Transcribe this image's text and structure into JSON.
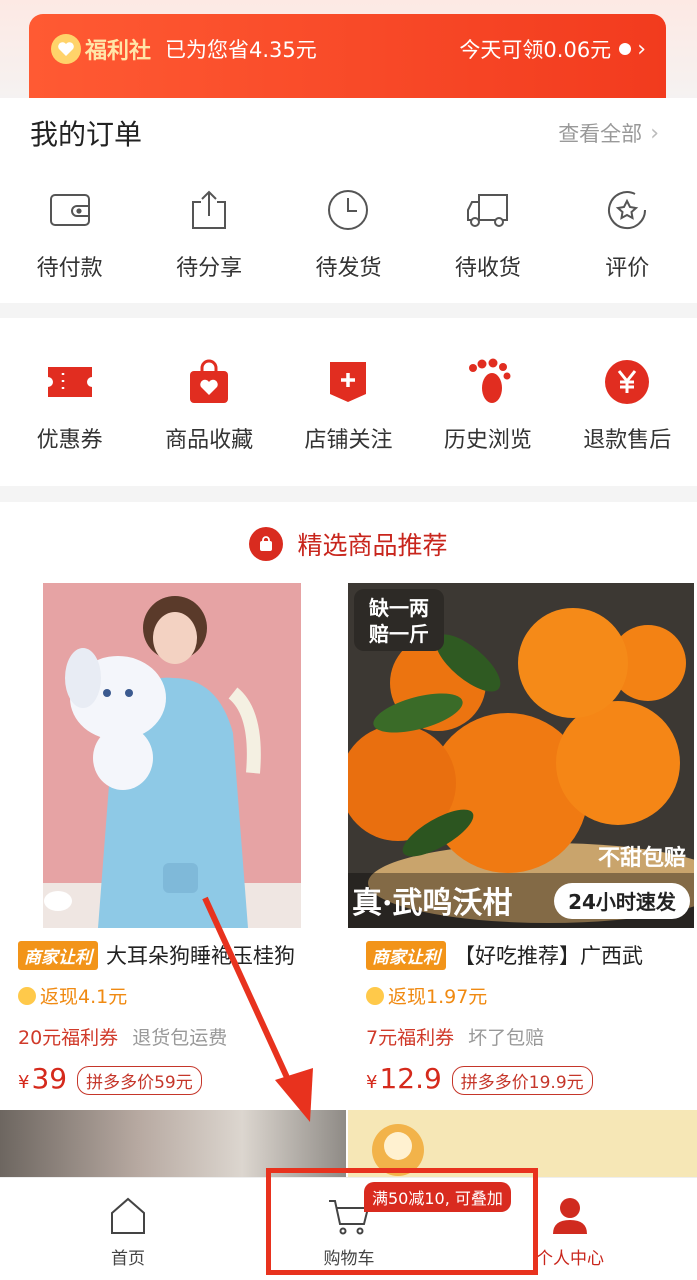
{
  "welfare": {
    "brand": "福利社",
    "saved_text": "已为您省4.35元",
    "today_text": "今天可领0.06元"
  },
  "orders": {
    "title": "我的订单",
    "view_all": "查看全部",
    "items": [
      {
        "label": "待付款",
        "icon": "wallet-icon"
      },
      {
        "label": "待分享",
        "icon": "share-icon"
      },
      {
        "label": "待发货",
        "icon": "clock-icon"
      },
      {
        "label": "待收货",
        "icon": "truck-icon"
      },
      {
        "label": "评价",
        "icon": "review-star-icon"
      }
    ]
  },
  "services": {
    "items": [
      {
        "label": "优惠券",
        "icon": "coupon-icon"
      },
      {
        "label": "商品收藏",
        "icon": "favorite-bag-icon"
      },
      {
        "label": "店铺关注",
        "icon": "shop-follow-icon"
      },
      {
        "label": "历史浏览",
        "icon": "footprint-icon"
      },
      {
        "label": "退款售后",
        "icon": "refund-yen-icon"
      }
    ]
  },
  "recommend": {
    "title": "精选商品推荐"
  },
  "products": [
    {
      "tag": "商家让利",
      "title": "大耳朵狗睡袍玉桂狗",
      "cashback": "返现4.1元",
      "coupon": "20元福利券",
      "extra": "退货包运费",
      "currency": "¥",
      "price": "39",
      "compare": "拼多多价59元"
    },
    {
      "tag": "商家让利",
      "title": "【好吃推荐】广西武",
      "cashback": "返现1.97元",
      "coupon": "7元福利券",
      "extra": "坏了包赔",
      "currency": "¥",
      "price": "12.9",
      "compare": "拼多多价19.9元",
      "image_text": {
        "corner_badge": "缺一两\n赔一斤",
        "right_badge": "不甜包赔",
        "bottom_title": "真·武鸣沃柑",
        "bottom_badge": "24小时速发"
      }
    }
  ],
  "tabbar": {
    "home": "首页",
    "cart": "购物车",
    "me": "个人中心",
    "cart_badge": "满50减10, 可叠加"
  },
  "colors": {
    "accent": "#e8321e",
    "welfare_bar": "#f23b1e",
    "price": "#d52a1c",
    "merchant_tag": "#f29419"
  }
}
